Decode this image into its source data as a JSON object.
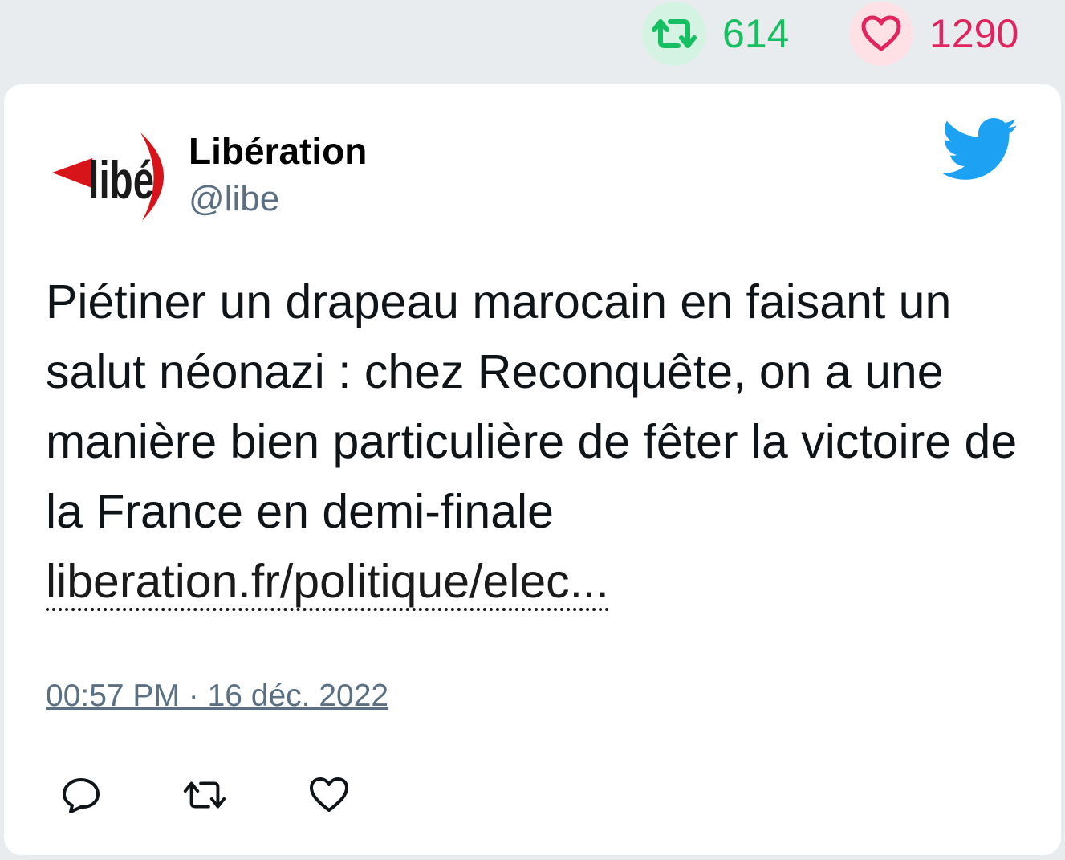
{
  "stats": {
    "retweets": "614",
    "likes": "1290"
  },
  "author": {
    "name": "Libération",
    "handle": "@libe",
    "logo_text": "libé"
  },
  "tweet": {
    "text": "Piétiner un drapeau marocain en faisant un salut néonazi : chez Reconquête, on a une manière bien particulière de fêter la victoire de la France en demi-finale ",
    "link": "liberation.fr/politique/elec...",
    "timestamp": "00:57 PM · 16 déc. 2022"
  },
  "icons": {
    "retweet_stat": "retweet-icon",
    "like_stat": "heart-icon",
    "brand": "twitter-bird-icon",
    "reply": "reply-icon",
    "retweet": "retweet-icon",
    "like": "like-icon"
  },
  "colors": {
    "retweet": "#17bf63",
    "like": "#e0245e",
    "twitter_blue": "#1da1f2",
    "handle": "#5b7083"
  }
}
